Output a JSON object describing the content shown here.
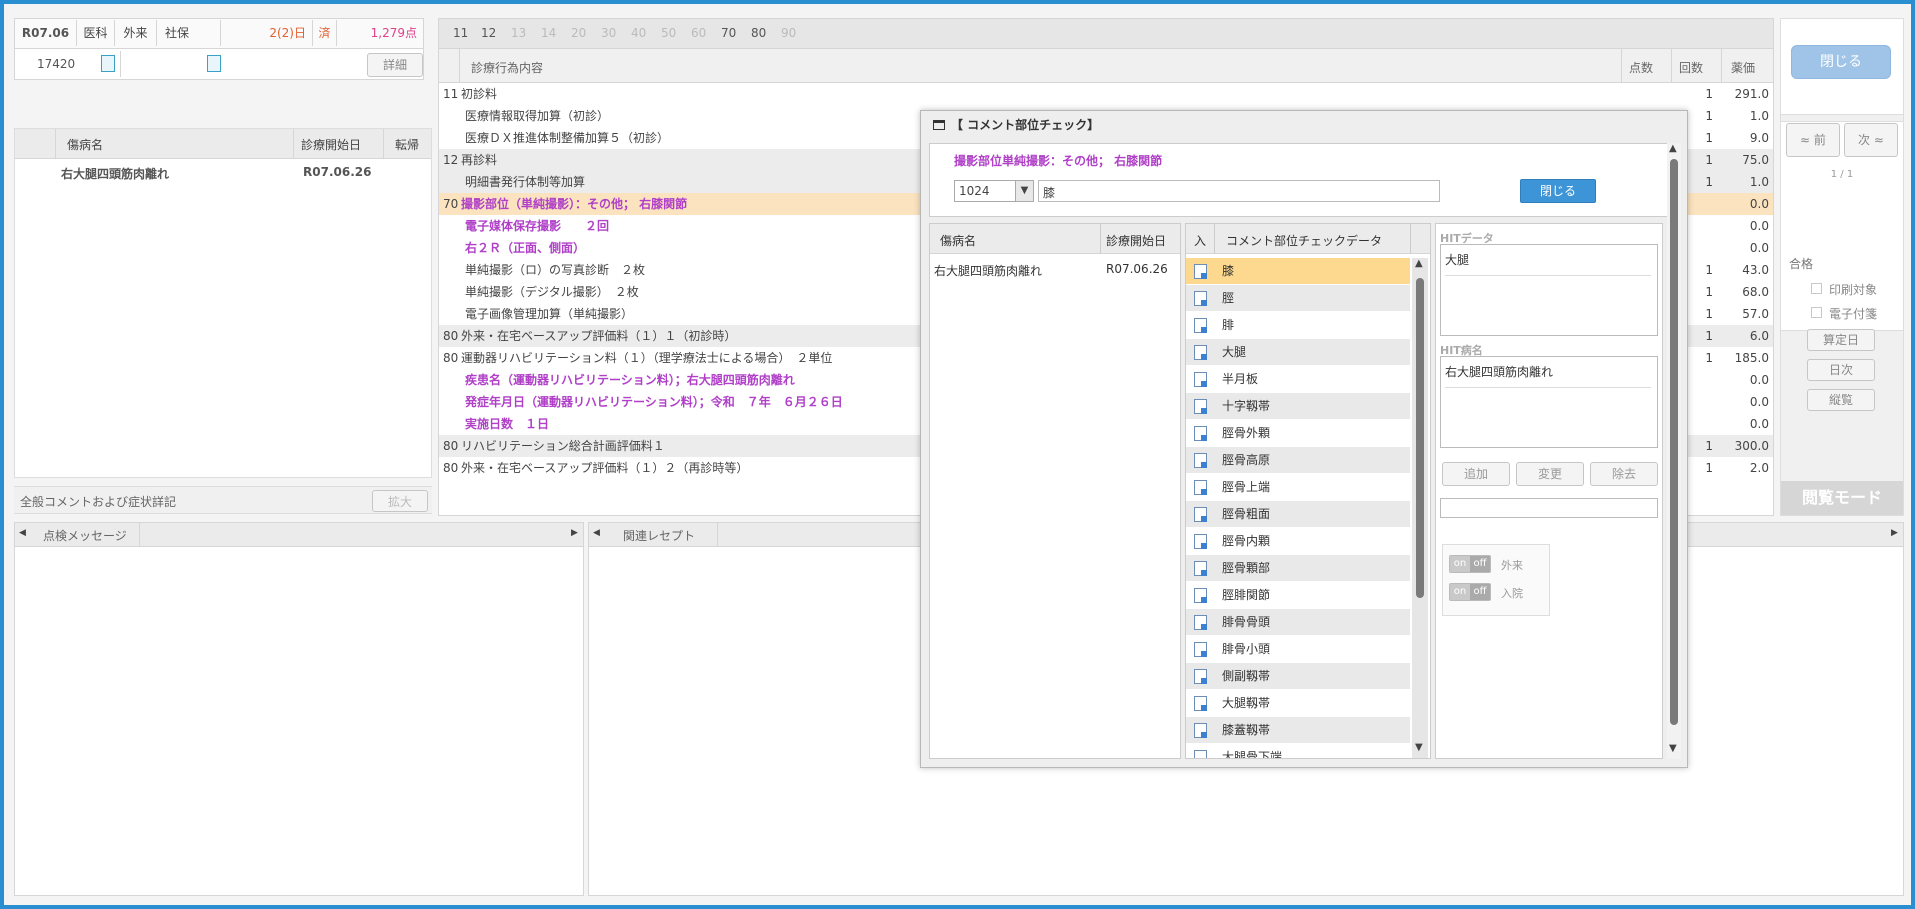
{
  "header": {
    "era": "R07.06",
    "dept": "医科",
    "visit": "外来",
    "insurance": "社保",
    "days": "2(2)日",
    "done": "済",
    "points": "1,279点",
    "patient_id": "17420",
    "detail_btn": "詳細"
  },
  "diag_table": {
    "col_name": "傷病名",
    "col_start": "診療開始日",
    "col_outcome": "転帰",
    "rows": [
      {
        "name": "右大腿四頭筋肉離れ",
        "date": "R07.06.26"
      }
    ]
  },
  "general_comment": {
    "label": "全般コメントおよび症状詳記",
    "expand_btn": "拡大"
  },
  "bottom_tabs": {
    "check_msg": "点検メッセージ",
    "related": "関連レセプト"
  },
  "category_tabs": [
    "11",
    "12",
    "13",
    "14",
    "20",
    "30",
    "40",
    "50",
    "60",
    "70",
    "80",
    "90"
  ],
  "procedures": {
    "col_content": "診療行為内容",
    "col_points": "点数",
    "col_count": "回数",
    "col_price": "薬価",
    "rows": [
      {
        "code": "11",
        "text": "初診料",
        "count": "1",
        "price": "291.0",
        "style": "normal"
      },
      {
        "code": "",
        "text": "医療情報取得加算（初診）",
        "count": "1",
        "price": "1.0",
        "style": "normal"
      },
      {
        "code": "",
        "text": "医療ＤＸ推進体制整備加算５（初診）",
        "count": "1",
        "price": "9.0",
        "style": "normal"
      },
      {
        "code": "12",
        "text": "再診料",
        "count": "1",
        "price": "75.0",
        "style": "gray"
      },
      {
        "code": "",
        "text": "明細書発行体制等加算",
        "count": "1",
        "price": "1.0",
        "style": "gray"
      },
      {
        "code": "70",
        "text": "撮影部位（単純撮影）：その他； 右膝関節",
        "count": "",
        "price": "0.0",
        "style": "orange"
      },
      {
        "code": "",
        "text": "電子媒体保存撮影　　２回",
        "count": "",
        "price": "0.0",
        "style": "purple"
      },
      {
        "code": "",
        "text": "右２Ｒ（正面、側面）",
        "count": "",
        "price": "0.0",
        "style": "purple"
      },
      {
        "code": "",
        "text": "単純撮影（ロ）の写真診断　２枚",
        "count": "1",
        "price": "43.0",
        "style": "normal"
      },
      {
        "code": "",
        "text": "単純撮影（デジタル撮影）　２枚",
        "count": "1",
        "price": "68.0",
        "style": "normal"
      },
      {
        "code": "",
        "text": "電子画像管理加算（単純撮影）",
        "count": "1",
        "price": "57.0",
        "style": "normal"
      },
      {
        "code": "80",
        "text": "外来・在宅ベースアップ評価料（１）１（初診時）",
        "count": "1",
        "price": "6.0",
        "style": "gray"
      },
      {
        "code": "80",
        "text": "運動器リハビリテーション料（１）（理学療法士による場合）　２単位",
        "count": "1",
        "price": "185.0",
        "style": "normal"
      },
      {
        "code": "",
        "text": "疾患名（運動器リハビリテーション料）；右大腿四頭筋肉離れ",
        "count": "",
        "price": "0.0",
        "style": "purple"
      },
      {
        "code": "",
        "text": "発症年月日（運動器リハビリテーション料）；令和　７年　６月２６日",
        "count": "",
        "price": "0.0",
        "style": "purple"
      },
      {
        "code": "",
        "text": "実施日数　１日",
        "count": "",
        "price": "0.0",
        "style": "purple"
      },
      {
        "code": "80",
        "text": "リハビリテーション総合計画評価料１",
        "count": "1",
        "price": "300.0",
        "style": "gray"
      },
      {
        "code": "80",
        "text": "外来・在宅ベースアップ評価料（１）２（再診時等）",
        "count": "1",
        "price": "2.0",
        "style": "normal"
      }
    ]
  },
  "right_panel": {
    "close": "閉じる",
    "prev": "前",
    "next": "次",
    "page": "1 / 1",
    "pass": "合格",
    "print_target": "印刷対象",
    "e_attach": "電子付箋",
    "calc_day": "算定日",
    "daily": "日次",
    "vertical": "縦覧",
    "mode": "閲覧モード"
  },
  "dialog": {
    "title": "【 コメント部位チェック】",
    "subtitle": "撮影部位単純撮影：その他； 右膝関節",
    "code_value": "1024",
    "search_value": "膝",
    "close_btn": "閉じる",
    "diag_col_name": "傷病名",
    "diag_col_date": "診療開始日",
    "diag_row": {
      "name": "右大腿四頭筋肉離れ",
      "date": "R07.06.26"
    },
    "list_col_in": "入",
    "list_col_data": "コメント部位チェックデータ",
    "list_items": [
      "膝",
      "脛",
      "腓",
      "大腿",
      "半月板",
      "十字靱帯",
      "脛骨外顆",
      "脛骨高原",
      "脛骨上端",
      "脛骨粗面",
      "脛骨内顆",
      "脛骨顆部",
      "脛腓関節",
      "腓骨骨頭",
      "腓骨小頭",
      "側副靱帯",
      "大腿靱帯",
      "膝蓋靱帯",
      "大腿骨下端"
    ],
    "hit_data_label": "HITデータ",
    "hit_data_value": "大腿",
    "hit_disease_label": "HIT病名",
    "hit_disease_value": "右大腿四頭筋肉離れ",
    "add_btn": "追加",
    "change_btn": "変更",
    "remove_btn": "除去",
    "toggle_on": "on",
    "toggle_off": "off",
    "outpatient": "外来",
    "inpatient": "入院"
  }
}
